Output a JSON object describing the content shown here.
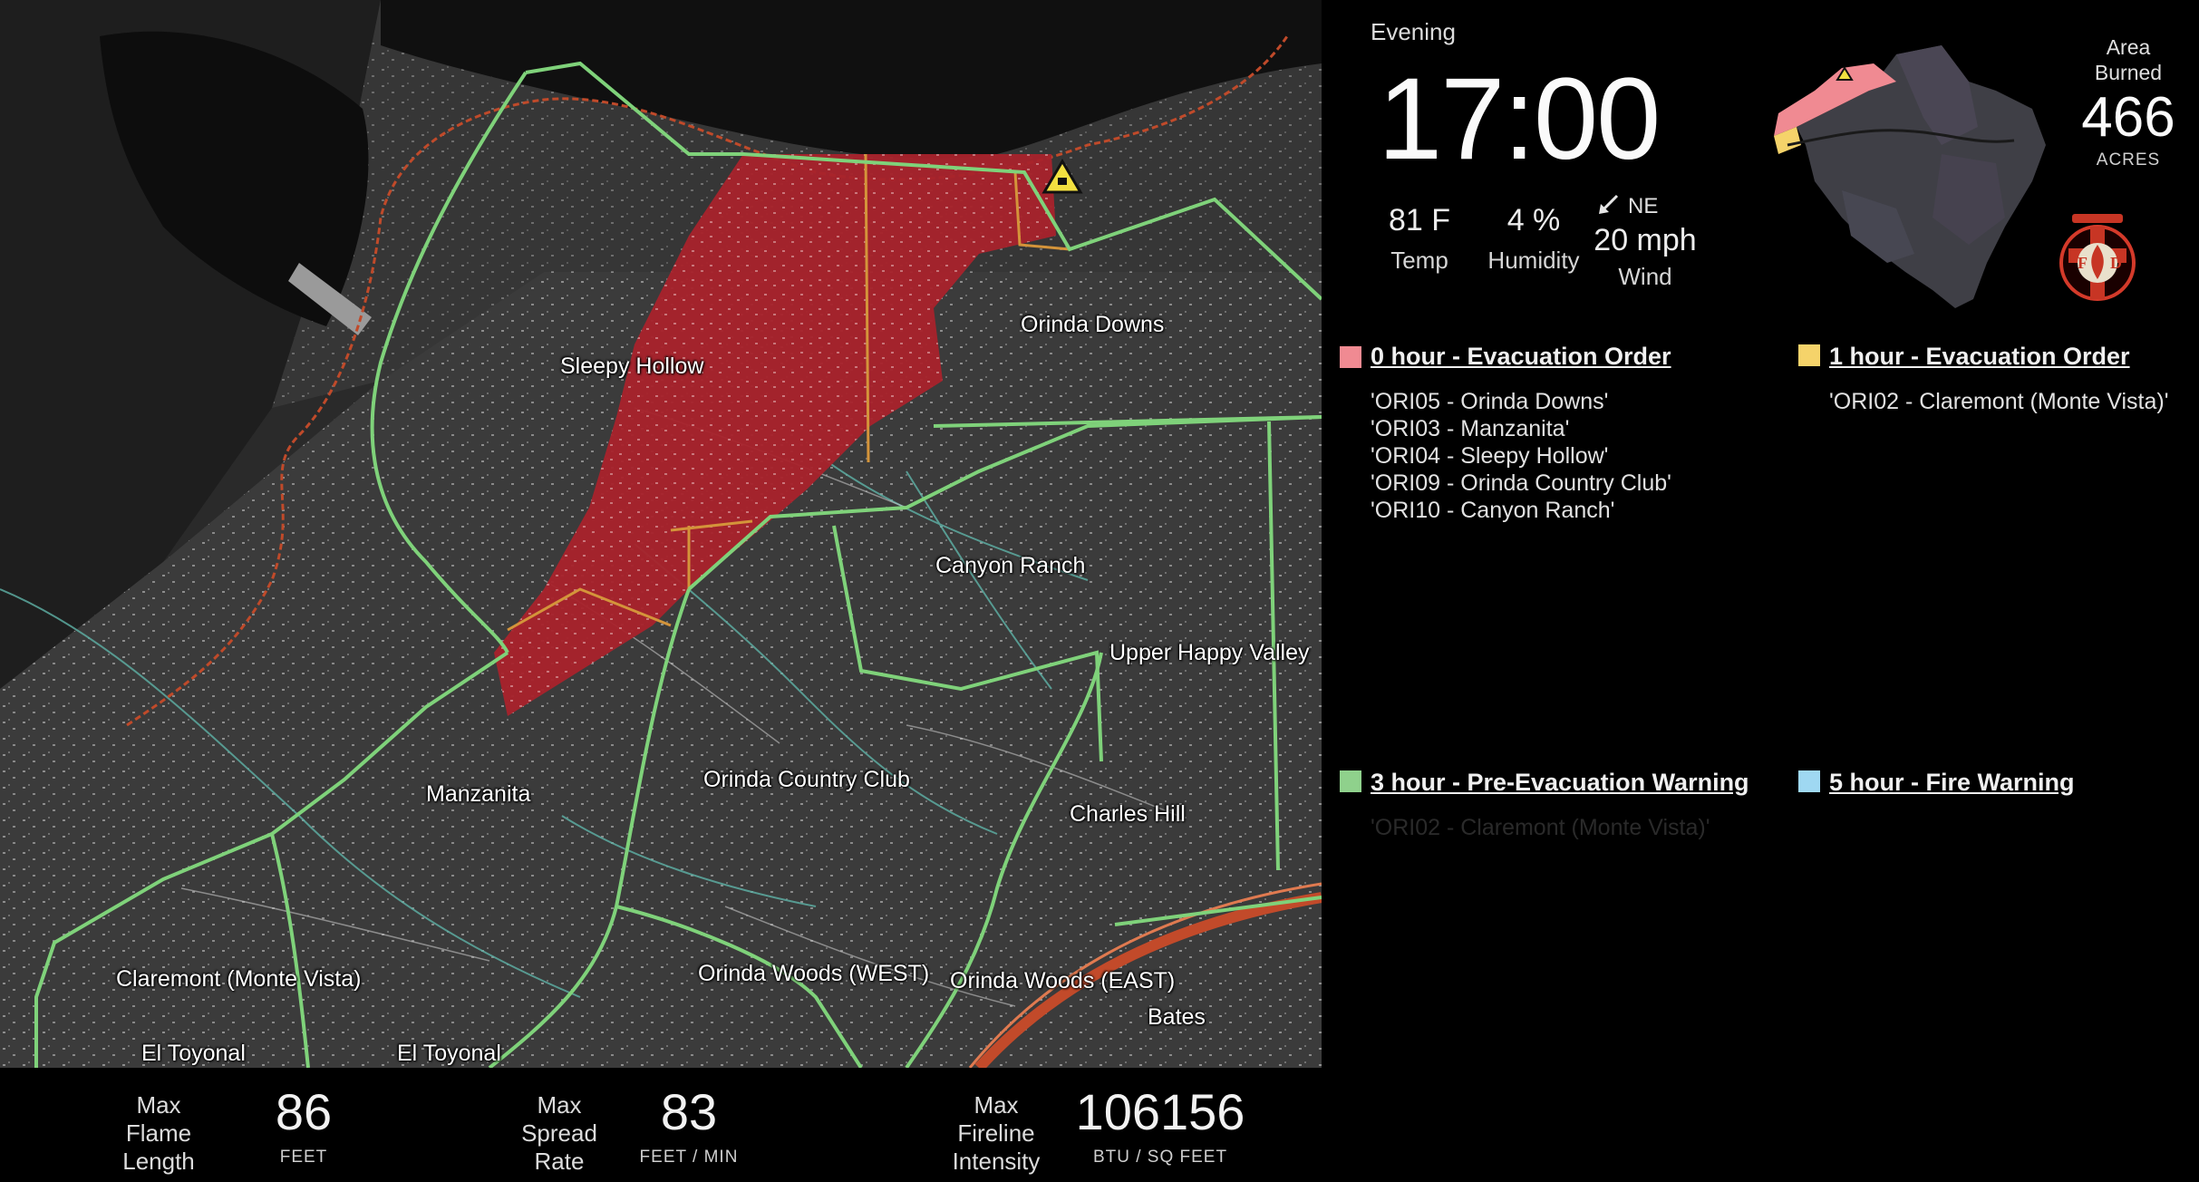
{
  "time_of_day": "Evening",
  "clock": "17:00",
  "weather": {
    "temp_value": "81 F",
    "temp_label": "Temp",
    "humidity_value": "4 %",
    "humidity_label": "Humidity",
    "wind_dir": "NE",
    "wind_value": "20 mph",
    "wind_label": "Wind"
  },
  "area": {
    "label": "Area\nBurned",
    "value": "466",
    "unit": "ACRES"
  },
  "map_labels": {
    "sleepy_hollow": "Sleepy Hollow",
    "orinda_downs": "Orinda Downs",
    "canyon_ranch": "Canyon Ranch",
    "upper_happy_valley": "Upper Happy Valley",
    "manzanita": "Manzanita",
    "orinda_country_club": "Orinda Country Club",
    "charles_hill": "Charles Hill",
    "claremont": "Claremont (Monte Vista)",
    "orinda_woods_west": "Orinda Woods (WEST)",
    "orinda_woods_east": "Orinda Woods (EAST)",
    "bates": "Bates",
    "el_toyonal_1": "El Toyonal",
    "el_toyonal_2": "El Toyonal"
  },
  "zones": {
    "zone0": {
      "title": "0 hour - Evacuation Order",
      "color": "#f08a92",
      "items": [
        "'ORI05 - Orinda Downs'",
        "'ORI03 - Manzanita'",
        "'ORI04 - Sleepy Hollow'",
        "'ORI09 - Orinda Country Club'",
        "'ORI10 - Canyon Ranch'"
      ]
    },
    "zone1": {
      "title": "1 hour - Evacuation Order",
      "color": "#f5d36a",
      "items": [
        "'ORI02 - Claremont (Monte Vista)'"
      ]
    },
    "zone3": {
      "title": "3 hour - Pre-Evacuation Warning",
      "color": "#8fd18c",
      "items": [
        "'ORI02 - Claremont (Monte Vista)'"
      ]
    },
    "zone5": {
      "title": "5 hour - Fire Warning",
      "color": "#9fd8f2",
      "items": []
    }
  },
  "stats": {
    "flame_label": "Max\nFlame\nLength",
    "flame_value": "86",
    "flame_unit": "FEET",
    "spread_label": "Max\nSpread\nRate",
    "spread_value": "83",
    "spread_unit": "FEET / MIN",
    "intensity_label": "Max\nFireline\nIntensity",
    "intensity_value": "106156",
    "intensity_unit": "BTU / SQ FEET"
  },
  "colors": {
    "fire": "#b3202a",
    "boundary": "#7fd27a",
    "road": "#d08a3a",
    "stream": "#5fb3a8"
  },
  "icons": {
    "ignition": "warning-triangle-icon",
    "badge": "fire-department-badge-icon",
    "wind_arrow": "arrow-southwest-icon"
  }
}
